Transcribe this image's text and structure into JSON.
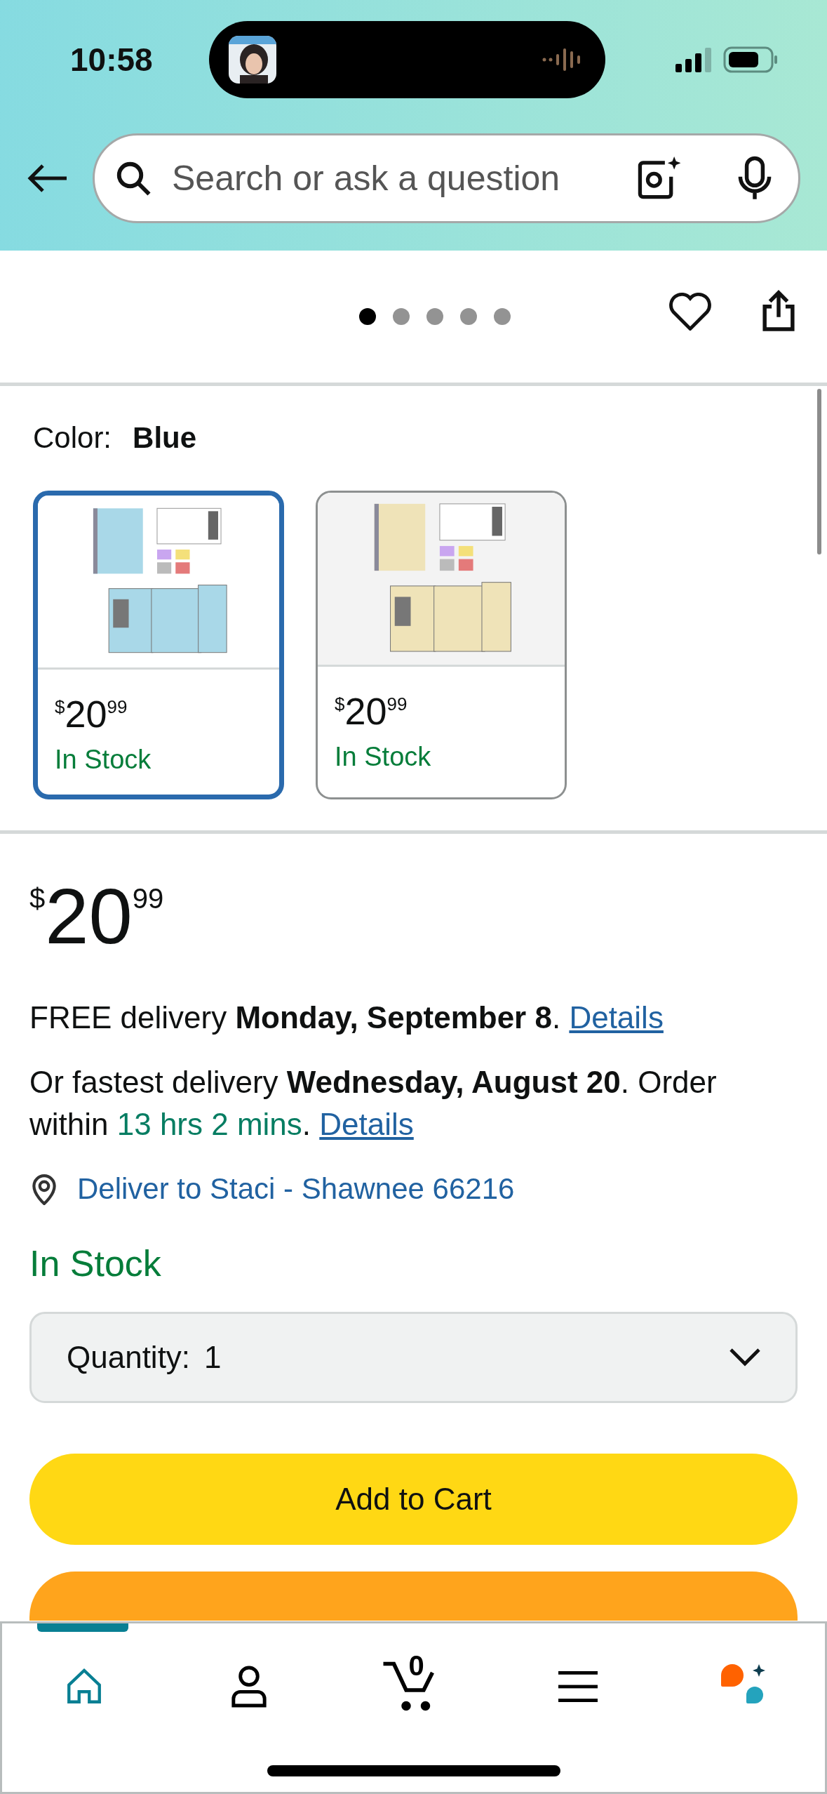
{
  "status_bar": {
    "time": "10:58"
  },
  "search": {
    "placeholder": "Search or ask a question"
  },
  "carousel": {
    "dots": [
      {
        "selected": true
      },
      {
        "selected": false
      },
      {
        "selected": false
      },
      {
        "selected": false
      },
      {
        "selected": false
      }
    ]
  },
  "color_picker": {
    "label": "Color:",
    "value": "Blue"
  },
  "swatches": [
    {
      "selected": true,
      "color": "#a9d8e8",
      "currency": "$",
      "whole": "20",
      "fraction": "99",
      "stock": "In Stock"
    },
    {
      "selected": false,
      "color": "#efe3b8",
      "currency": "$",
      "whole": "20",
      "fraction": "99",
      "stock": "In Stock"
    }
  ],
  "price": {
    "currency": "$",
    "whole": "20",
    "fraction": "99"
  },
  "delivery": [
    [
      {
        "kind": "text",
        "text": "FREE delivery **Monday, September 8**. "
      },
      {
        "kind": "link",
        "text": "Details"
      }
    ],
    [
      {
        "kind": "text",
        "text": "Or fastest delivery **Wednesday, August 20**. Order within "
      },
      {
        "kind": "highlight",
        "text": "13 hrs 2 mins"
      },
      {
        "kind": "text",
        "text": ". "
      },
      {
        "kind": "link",
        "text": "Details"
      }
    ]
  ],
  "deliver_to": "Deliver to Staci - Shawnee 66216",
  "availability": "In Stock",
  "quantity": {
    "label": "Quantity:",
    "value": "1"
  },
  "buttons": [
    {
      "kind": "primary",
      "label": "Add to Cart"
    },
    {
      "kind": "secondary"
    }
  ],
  "tab_bar": [
    {
      "kind": "home",
      "selected": true
    },
    {
      "kind": "profile",
      "selected": false
    },
    {
      "kind": "cart",
      "selected": false,
      "badge": "0"
    },
    {
      "kind": "menu",
      "selected": false
    },
    {
      "kind": "assistant",
      "selected": false
    }
  ]
}
